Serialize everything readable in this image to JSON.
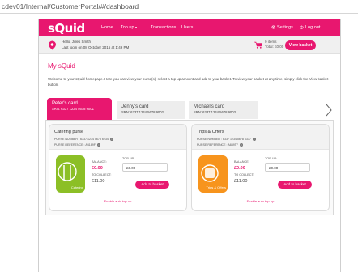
{
  "browser": {
    "url": "cdev01/Internal/CustomerPortal/#/dashboard"
  },
  "nav": {
    "logo": "sQuid",
    "items": [
      "Home",
      "Top up",
      "Transactions",
      "Users"
    ],
    "topup_caret": "▾",
    "settings": "Settings",
    "logout": "Log out"
  },
  "userbar": {
    "greeting": "Hello, Jules Smith",
    "last_login": "Last login on 08 October 2015 at 1:49 PM",
    "basket_items": "0 items",
    "basket_total": "Total: £0.00",
    "view_basket": "View basket"
  },
  "page": {
    "title": "My sQuid",
    "intro": "Welcome to your sQuid homepage. Here you can view your purse(s), select a top up amount and add to your basket. To view your basket at any time, simply click the View basket button."
  },
  "tabs": [
    {
      "name": "Peter's card",
      "srn": "SRN: 6337 1234 5678 9001",
      "active": true
    },
    {
      "name": "Jenny's card",
      "srn": "SRN: 6337 1234 5678 9002",
      "active": false
    },
    {
      "name": "Michael's card",
      "srn": "SRN: 6337 1234 5678 9003",
      "active": false
    }
  ],
  "purses": [
    {
      "title": "Catering purse",
      "purse_number": "PURSE NUMBER : 6337 1234 5678 6234",
      "purse_reference": "PURSE REFERENCE : A4189F",
      "tile_label": "Catering",
      "tile_color": "#8cbf26",
      "balance_label": "BALANCE:",
      "balance": "£0.00",
      "to_collect_label": "TO COLLECT:",
      "to_collect": "£11.00",
      "topup_label": "TOP UP:",
      "topup_value": "£0.00",
      "add_label": "Add to basket",
      "auto_topup": "Enable auto top-up"
    },
    {
      "title": "Trips & Offers",
      "purse_number": "PURSE NUMBER : 6337 1234 5678 6337",
      "purse_reference": "PURSE REFERENCE : A849TF",
      "tile_label": "Trips & Offers",
      "tile_color": "#f7941d",
      "balance_label": "BALANCE:",
      "balance": "£0.00",
      "to_collect_label": "TO COLLECT:",
      "to_collect": "£11.00",
      "topup_label": "TOP UP:",
      "topup_value": "£0.00",
      "add_label": "Add to basket",
      "auto_topup": "Enable auto top-up"
    }
  ],
  "colors": {
    "brand": "#e8176f",
    "catering": "#8cbf26",
    "trips": "#f7941d"
  }
}
